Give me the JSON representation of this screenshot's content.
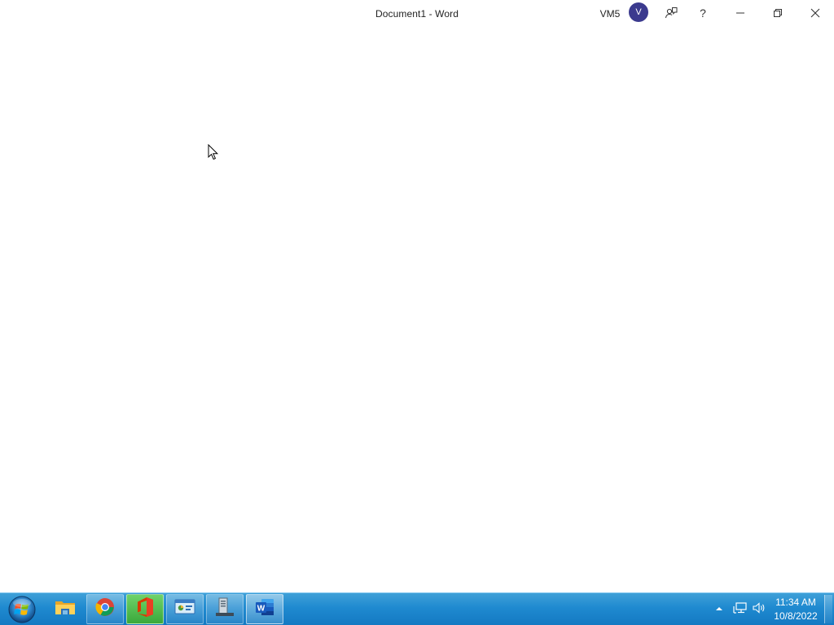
{
  "window": {
    "title": "Document1  -  Word",
    "account_name": "VM5",
    "avatar_initial": "V",
    "help_glyph": "?",
    "icons": {
      "coauthoring": "coauthoring-icon",
      "minimize": "minimize-icon",
      "restore": "restore-icon",
      "close": "close-icon"
    }
  },
  "taskbar": {
    "apps": [
      {
        "name": "file-explorer",
        "icon": "folder-icon"
      },
      {
        "name": "chrome",
        "icon": "chrome-icon"
      },
      {
        "name": "office",
        "icon": "office-icon"
      },
      {
        "name": "control-panel",
        "icon": "control-panel-icon"
      },
      {
        "name": "server-manager",
        "icon": "server-icon"
      },
      {
        "name": "word",
        "icon": "word-icon"
      }
    ],
    "tray": {
      "time": "11:34 AM",
      "date": "10/8/2022"
    }
  },
  "colors": {
    "avatar": "#3b3a8e",
    "taskbar": "#1f8ad0",
    "word_blue": "#2b579a",
    "office_orange": "#d83b01"
  }
}
